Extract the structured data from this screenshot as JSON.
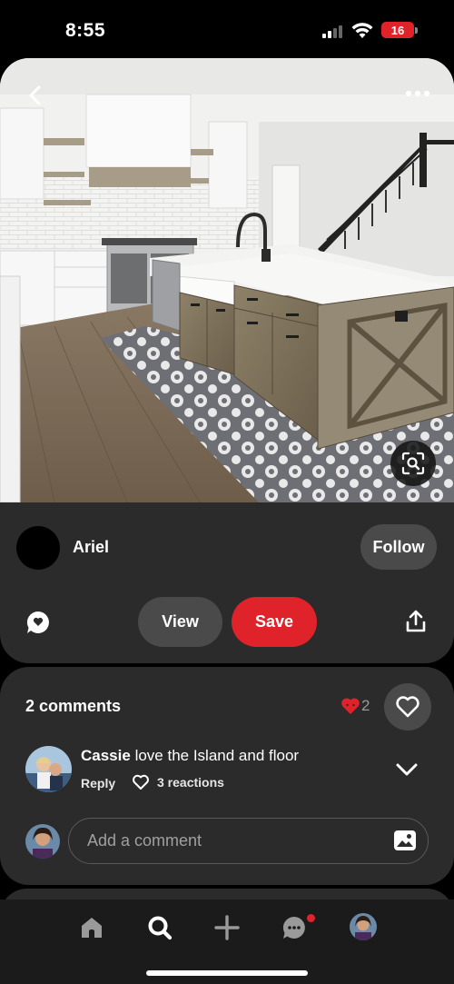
{
  "status_bar": {
    "time": "8:55",
    "battery": "16",
    "battery_color": "#e0232b"
  },
  "pin": {
    "image_description_icon": "kitchen-photo",
    "creator_name": "Ariel",
    "follow_label": "Follow",
    "view_label": "View",
    "save_label": "Save",
    "accent_color": "#e0232b"
  },
  "comments": {
    "title": "2 comments",
    "reaction_count": "2",
    "items": [
      {
        "author": "Cassie",
        "text": "love the Island and floor",
        "reply_label": "Reply",
        "reactions_label": "3 reactions"
      }
    ],
    "input_placeholder": "Add a comment"
  },
  "bottom_nav": {
    "items": [
      "home-icon",
      "search-icon",
      "create-icon",
      "messages-icon",
      "profile-avatar"
    ],
    "messages_has_notification": true
  }
}
